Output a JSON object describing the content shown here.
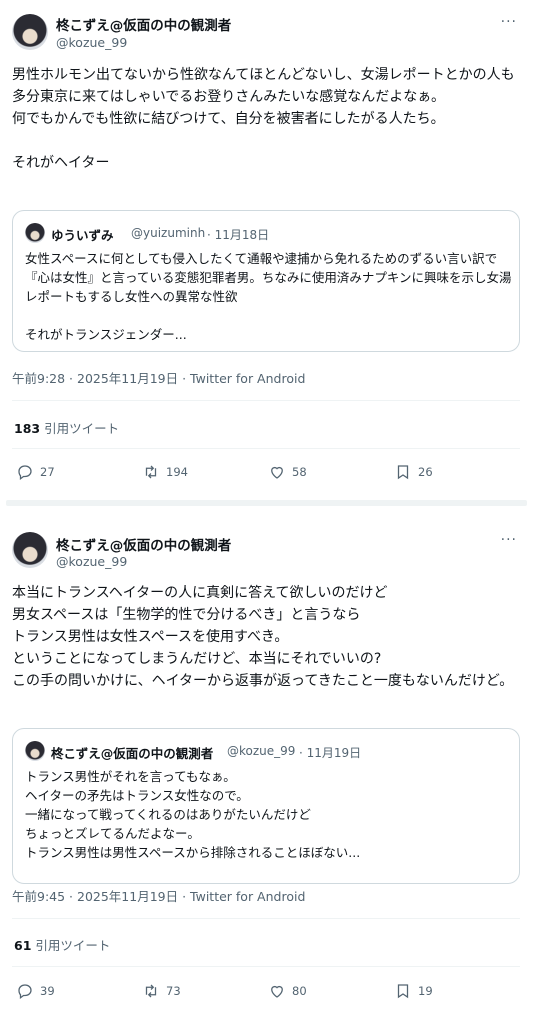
{
  "tweets": [
    {
      "author": "柊こずえ@仮面の中の観測者",
      "handle": "@kozue_99",
      "more": "···",
      "text": "男性ホルモン出てないから性欲なんてほとんどないし、女湯レポートとかの人も多分東京に来てはしゃいでるお登りさんみたいな感覚なんだよなぁ。\n何でもかんでも性欲に結びつけて、自分を被害者にしたがる人たち。\n\nそれがヘイター",
      "quote": {
        "author": "ゆういずみ",
        "handle": "@yuizuminh",
        "date": "· 11月18日",
        "text": "女性スペースに何としても侵入したくて通報や逮捕から免れるためのずるい言い訳で『心は女性』と言っている変態犯罪者男。ちなみに使用済みナプキンに興味を示し女湯レポートもするし女性への異常な性欲\n\nそれがトランスジェンダー..."
      },
      "timestamp": "午前9:28 · 2025年11月19日 · Twitter for Android",
      "quote_count": "183",
      "quote_label": "引用ツイート",
      "stats": {
        "replies": "27",
        "retweets": "194",
        "likes": "58",
        "bookmarks": "26"
      }
    },
    {
      "author": "柊こずえ@仮面の中の観測者",
      "handle": "@kozue_99",
      "more": "···",
      "text": "本当にトランスヘイターの人に真剣に答えて欲しいのだけど\n男女スペースは「生物学的性で分けるべき」と言うなら\nトランス男性は女性スペースを使用すべき。\nということになってしまうんだけど、本当にそれでいいの?\nこの手の問いかけに、ヘイターから返事が返ってきたこと一度もないんだけど。",
      "quote": {
        "author": "柊こずえ@仮面の中の観測者",
        "handle": "@kozue_99",
        "date": "· 11月19日",
        "text": "トランス男性がそれを言ってもなぁ。\nヘイターの矛先はトランス女性なので。\n一緒になって戦ってくれるのはありがたいんだけど\nちょっとズレてるんだよなー。\nトランス男性は男性スペースから排除されることほぼない..."
      },
      "timestamp": "午前9:45 · 2025年11月19日 · Twitter for Android",
      "quote_count": "61",
      "quote_label": "引用ツイート",
      "stats": {
        "replies": "39",
        "retweets": "73",
        "likes": "80",
        "bookmarks": "19"
      }
    }
  ],
  "icons": {
    "reply": "reply-icon",
    "retweet": "retweet-icon",
    "like": "heart-icon",
    "bookmark": "bookmark-icon"
  },
  "colors": {
    "text": "#0f1419",
    "muted": "#536471",
    "border": "#cfd9de",
    "divider": "#eff3f4"
  }
}
